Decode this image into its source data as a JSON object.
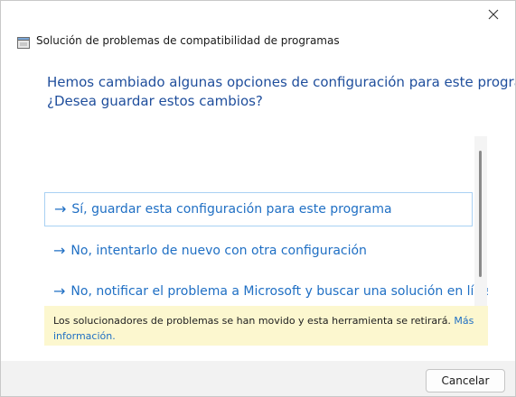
{
  "window": {
    "title": "Solución de problemas de compatibilidad de programas",
    "app_icon": "compatibility-troubleshooter-icon",
    "close_icon": "close-icon"
  },
  "prompt": {
    "line1": "Hemos cambiado algunas opciones de configuración para este programa.",
    "line2": "¿Desea guardar estos cambios?"
  },
  "options": [
    {
      "arrow": "→",
      "label": "Sí, guardar esta configuración para este programa",
      "selected": true
    },
    {
      "arrow": "→",
      "label": "No, intentarlo de nuevo con otra configuración",
      "selected": false
    },
    {
      "arrow": "→",
      "label": "No, notificar el problema a Microsoft y buscar una solución en línea",
      "selected": false
    }
  ],
  "notice": {
    "text": "Los solucionadores de problemas se han movido y esta herramienta se retirará. ",
    "link_line1": "Más",
    "link_line2": "información."
  },
  "footer": {
    "cancel_label": "Cancelar"
  },
  "colors": {
    "heading": "#1f4e9c",
    "link": "#1f6fc4",
    "notice_bg": "#fcf7cf",
    "selected_border": "#a9d1f3"
  }
}
